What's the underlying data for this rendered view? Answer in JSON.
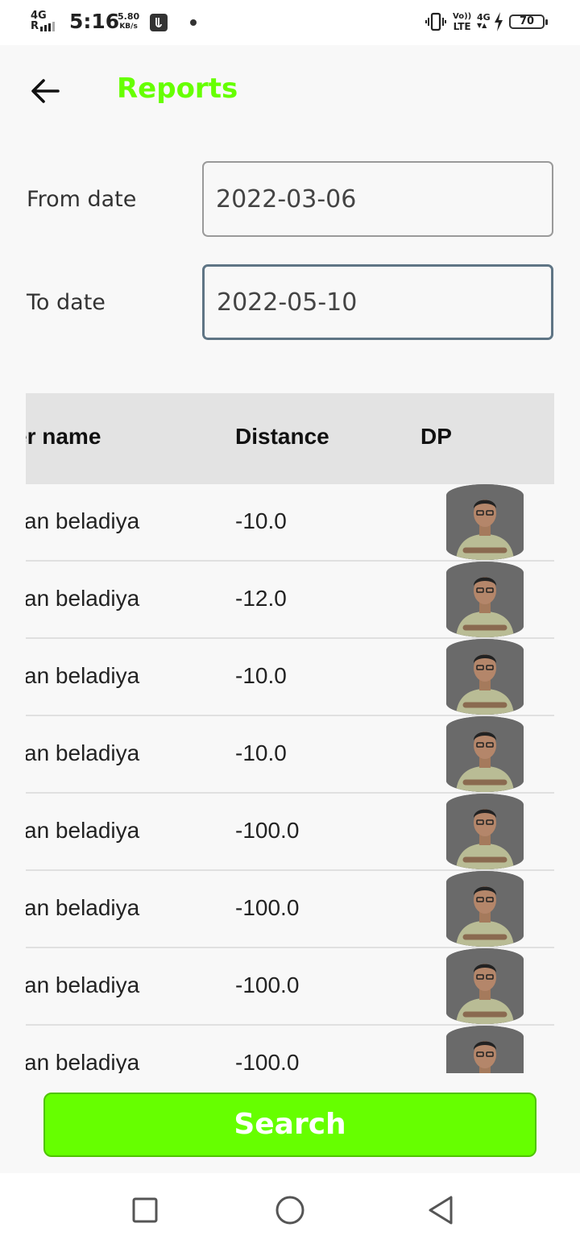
{
  "status_bar": {
    "network_top": "4G",
    "network_bottom": "R",
    "time": "5:16",
    "speed_value": "5.80",
    "speed_unit": "KB/s",
    "volte_top": "Vo))",
    "volte_bottom": "LTE",
    "data_type": "4G",
    "battery": "70"
  },
  "header": {
    "title": "Reports",
    "title_color": "#66ff00"
  },
  "form": {
    "from_label": "From date",
    "from_value": "2022-03-06",
    "to_label": "To date",
    "to_value": "2022-05-10"
  },
  "table": {
    "headers": [
      "er name",
      "Distance",
      "DP"
    ],
    "rows": [
      {
        "name": "an beladiya",
        "distance": "-10.0"
      },
      {
        "name": "an beladiya",
        "distance": "-12.0"
      },
      {
        "name": "an beladiya",
        "distance": "-10.0"
      },
      {
        "name": "an beladiya",
        "distance": "-10.0"
      },
      {
        "name": "an beladiya",
        "distance": "-100.0"
      },
      {
        "name": "an beladiya",
        "distance": "-100.0"
      },
      {
        "name": "an beladiya",
        "distance": "-100.0"
      },
      {
        "name": "an beladiya",
        "distance": "-100.0"
      }
    ]
  },
  "search_button": {
    "label": "Search",
    "color": "#66ff00"
  },
  "icons": {
    "back": "arrow-left-icon",
    "recents": "square-icon",
    "home": "circle-icon",
    "nav_back": "triangle-left-icon"
  }
}
